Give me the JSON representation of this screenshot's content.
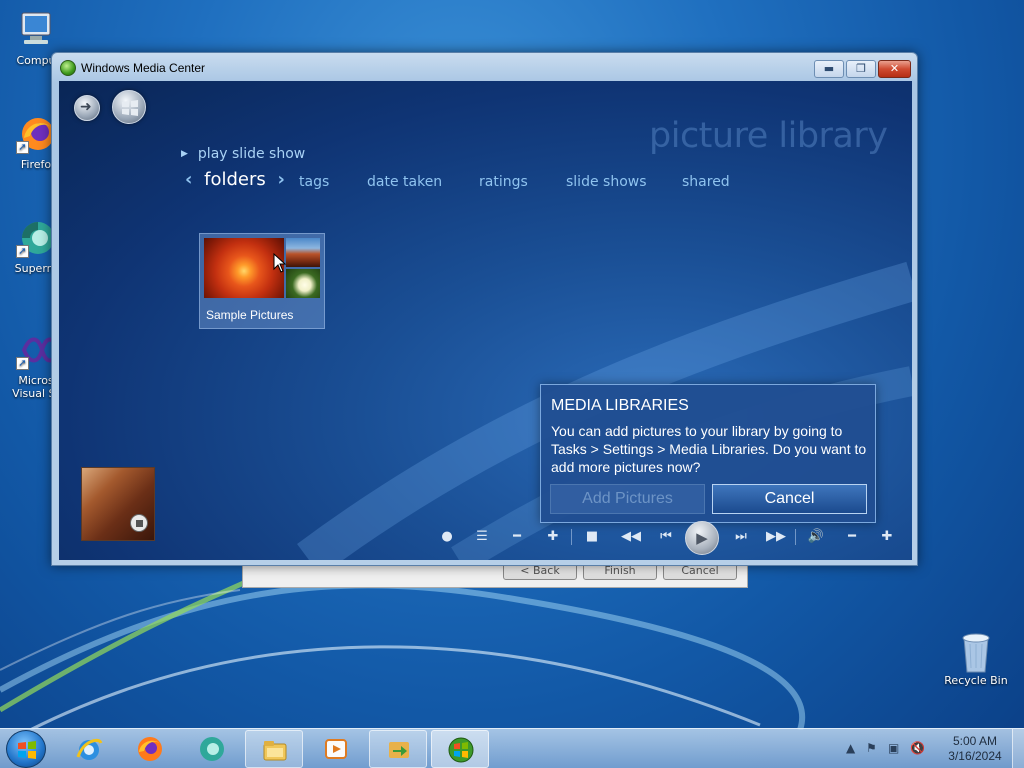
{
  "desktop": {
    "icons": [
      {
        "label": "Compu",
        "icon": "computer-icon"
      },
      {
        "label": "Firefo",
        "icon": "firefox-icon"
      },
      {
        "label": "Superm",
        "icon": "supermium-icon"
      },
      {
        "label": "Micros",
        "label2": "Visual St",
        "icon": "visual-studio-icon"
      },
      {
        "label": "Recycle Bin",
        "icon": "recycle-bin-icon"
      }
    ]
  },
  "background_dialog": {
    "buttons": [
      "< Back",
      "Finish",
      "Cancel"
    ]
  },
  "window": {
    "title": "Windows Media Center",
    "controls": [
      "minimize",
      "maximize",
      "close"
    ]
  },
  "media_center": {
    "header": "picture library",
    "play_action": "play slide show",
    "current_view": "folders",
    "views": [
      "tags",
      "date taken",
      "ratings",
      "slide shows",
      "shared"
    ],
    "folder_tile": {
      "label": "Sample Pictures"
    }
  },
  "dialog": {
    "title": "MEDIA LIBRARIES",
    "body": "You can add pictures to your library by going to Tasks > Settings > Media Libraries. Do you want to add more pictures now?",
    "add_button": "Add Pictures",
    "cancel_button": "Cancel",
    "add_disabled": true
  },
  "transport_icons": [
    "record-icon",
    "guide-icon",
    "channel-down-icon",
    "channel-up-icon",
    "stop-icon",
    "rewind-icon",
    "skip-back-icon",
    "play-icon",
    "skip-forward-icon",
    "fast-forward-icon",
    "volume-icon",
    "volume-down-icon",
    "volume-up-icon"
  ],
  "taskbar": {
    "apps": [
      "internet-explorer-icon",
      "firefox-icon",
      "supermium-icon",
      "file-explorer-icon",
      "media-player-icon",
      "migration-icon",
      "media-center-icon"
    ],
    "time": "5:00 AM",
    "date": "3/16/2024"
  }
}
